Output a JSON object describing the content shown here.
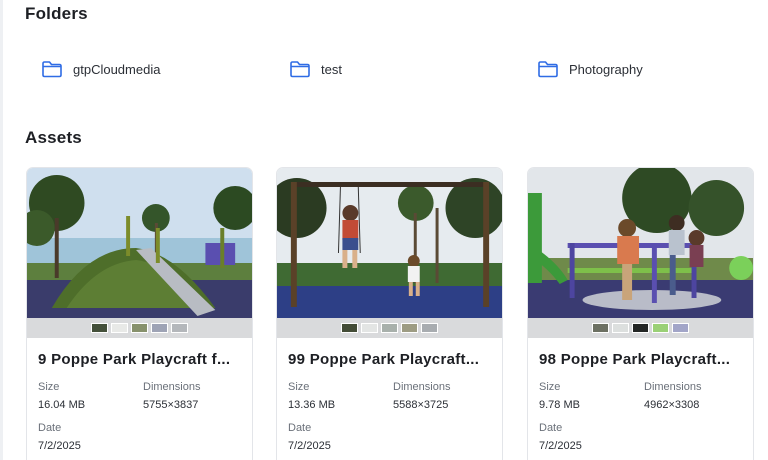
{
  "folders": {
    "title": "Folders",
    "items": [
      {
        "label": "gtpCloudmedia",
        "icon": "folder-icon"
      },
      {
        "label": "test",
        "icon": "folder-icon"
      },
      {
        "label": "Photography",
        "icon": "folder-icon"
      }
    ]
  },
  "assets": {
    "title": "Assets",
    "size_label": "Size",
    "dimensions_label": "Dimensions",
    "date_label": "Date",
    "cards": [
      {
        "title": "9 Poppe Park Playcraft f...",
        "size": "16.04 MB",
        "dimensions": "5755×3837",
        "date": "7/2/2025",
        "swatches": [
          "#44503a",
          "#e8e9e7",
          "#87916c",
          "#9ea3b5",
          "#b4b7bb"
        ]
      },
      {
        "title": "99 Poppe Park Playcraft...",
        "size": "13.36 MB",
        "dimensions": "5588×3725",
        "date": "7/2/2025",
        "swatches": [
          "#434c36",
          "#e3e5e4",
          "#a8b0ab",
          "#9d9c83",
          "#a8acb0"
        ]
      },
      {
        "title": "98 Poppe Park Playcraft...",
        "size": "9.78 MB",
        "dimensions": "4962×3308",
        "date": "7/2/2025",
        "swatches": [
          "#6c7062",
          "#dcdfde",
          "#232625",
          "#9ad076",
          "#a2a5c8"
        ]
      }
    ]
  },
  "colors": {
    "folder_icon": "#2f6ce5",
    "card_border": "#e3e5e9",
    "swatch_bar": "#d9dadc"
  }
}
